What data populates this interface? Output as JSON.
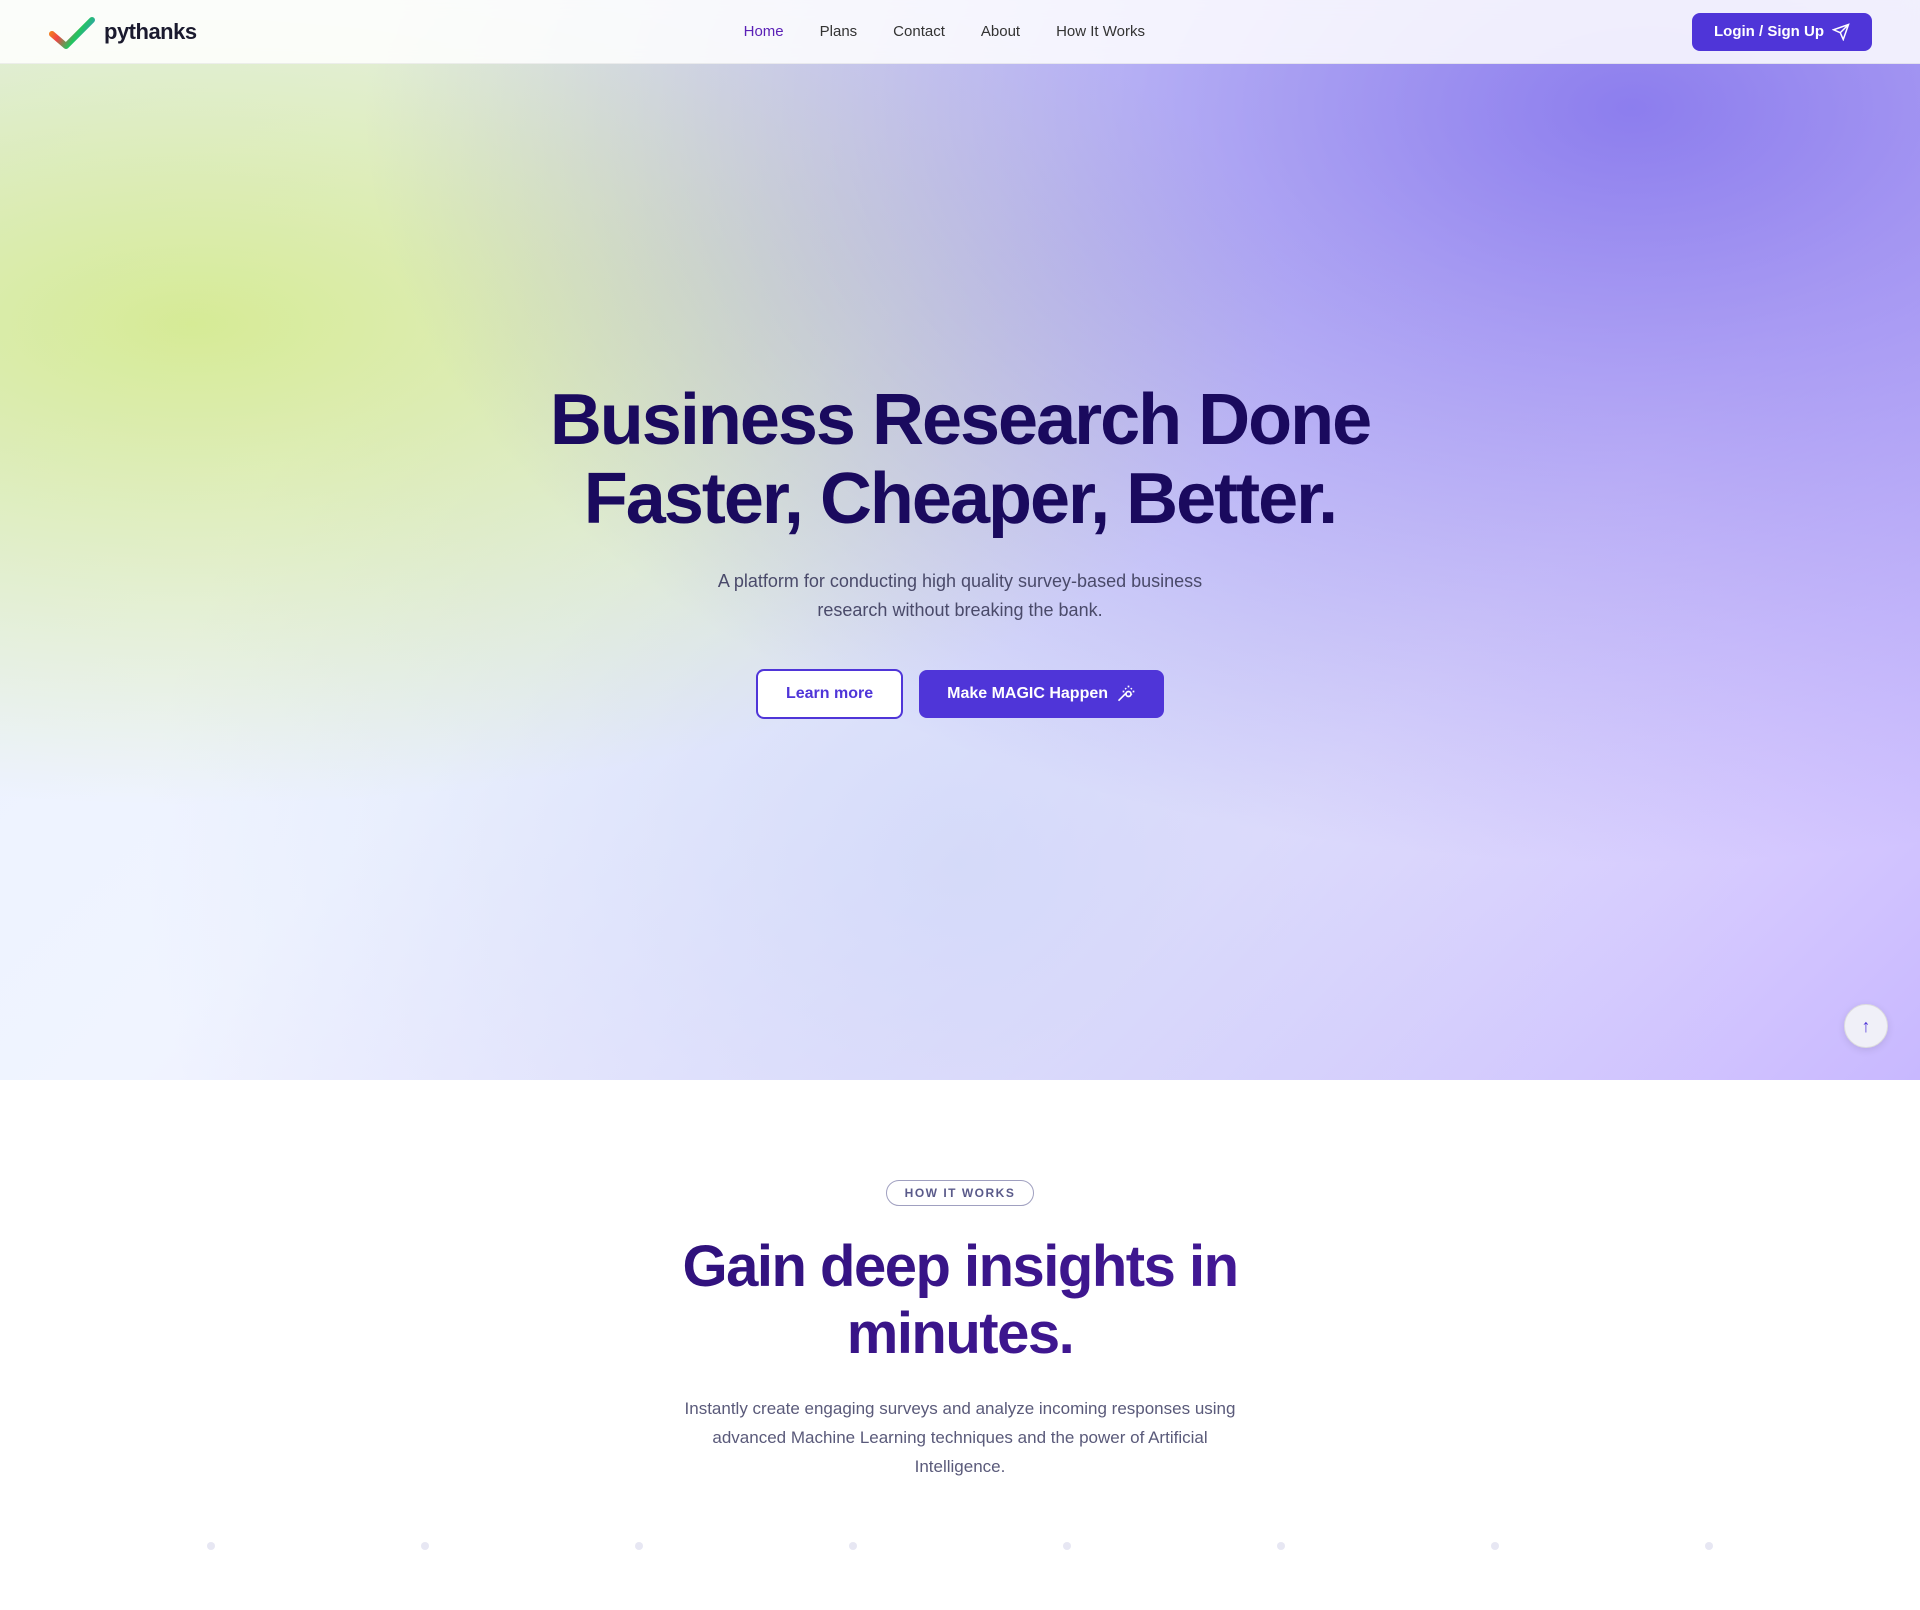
{
  "nav": {
    "logo_text": "pythanks",
    "links": [
      {
        "id": "home",
        "label": "Home",
        "active": true
      },
      {
        "id": "plans",
        "label": "Plans",
        "active": false
      },
      {
        "id": "contact",
        "label": "Contact",
        "active": false
      },
      {
        "id": "about",
        "label": "About",
        "active": false
      },
      {
        "id": "how-it-works",
        "label": "How It Works",
        "active": false
      }
    ],
    "cta_label": "Login / Sign Up",
    "cta_icon": "✈"
  },
  "hero": {
    "title_line1": "Business Research Done",
    "title_line2": "Faster, Cheaper, Better.",
    "subtitle": "A platform for conducting high quality survey-based business research without breaking the bank.",
    "btn_learn": "Learn more",
    "btn_magic": "Make MAGIC Happen",
    "btn_magic_icon": "✦"
  },
  "how_it_works": {
    "badge": "HOW IT WORKS",
    "title_line1": "Gain deep insights in",
    "title_line2": "minutes.",
    "description": "Instantly create engaging surveys and analyze incoming responses using advanced Machine Learning techniques and the power of Artificial Intelligence."
  },
  "scroll_up": {
    "icon": "↑"
  }
}
